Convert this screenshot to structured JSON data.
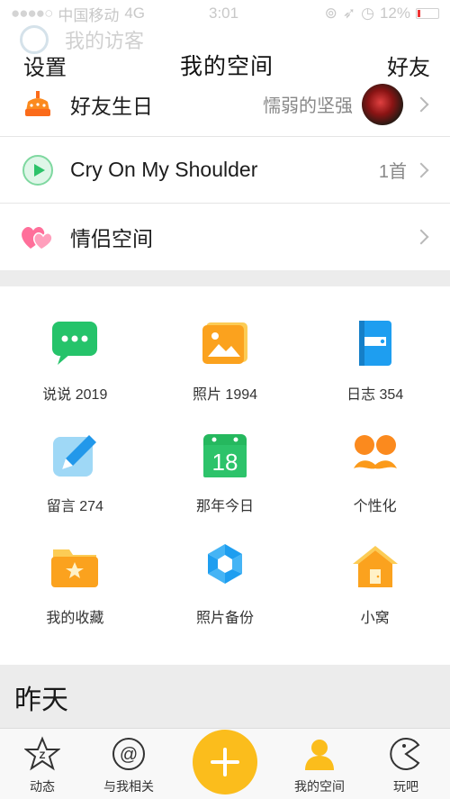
{
  "status_bar": {
    "carrier": "中国移动",
    "network": "4G",
    "time": "3:01",
    "battery": "12%"
  },
  "header": {
    "ghost_label": "我的访客",
    "left": "设置",
    "title": "我的空间",
    "right": "好友"
  },
  "list": [
    {
      "label": "好友生日",
      "value": "懦弱的坚强",
      "icon": "birthday-cake-icon"
    },
    {
      "label": "Cry On My Shoulder",
      "value": "1首",
      "icon": "music-play-icon"
    },
    {
      "label": "情侣空间",
      "value": "",
      "icon": "hearts-icon"
    }
  ],
  "grid": [
    {
      "label": "说说 2019",
      "icon": "chat-bubble-icon"
    },
    {
      "label": "照片 1994",
      "icon": "photo-icon"
    },
    {
      "label": "日志 354",
      "icon": "diary-icon"
    },
    {
      "label": "留言 274",
      "icon": "pen-icon"
    },
    {
      "label": "那年今日",
      "icon": "calendar-icon"
    },
    {
      "label": "个性化",
      "icon": "mustache-icon"
    },
    {
      "label": "我的收藏",
      "icon": "folder-star-icon"
    },
    {
      "label": "照片备份",
      "icon": "backup-icon"
    },
    {
      "label": "小窝",
      "icon": "house-icon"
    }
  ],
  "section_title": "昨天",
  "calendar_day": "18",
  "tabbar": {
    "items": [
      "动态",
      "与我相关",
      "我的空间",
      "玩吧"
    ],
    "plus": "+"
  },
  "colors": {
    "accent": "#fbbd1c",
    "green": "#2dc36a",
    "orange": "#fb9a1a",
    "blue": "#1e9ef0"
  }
}
